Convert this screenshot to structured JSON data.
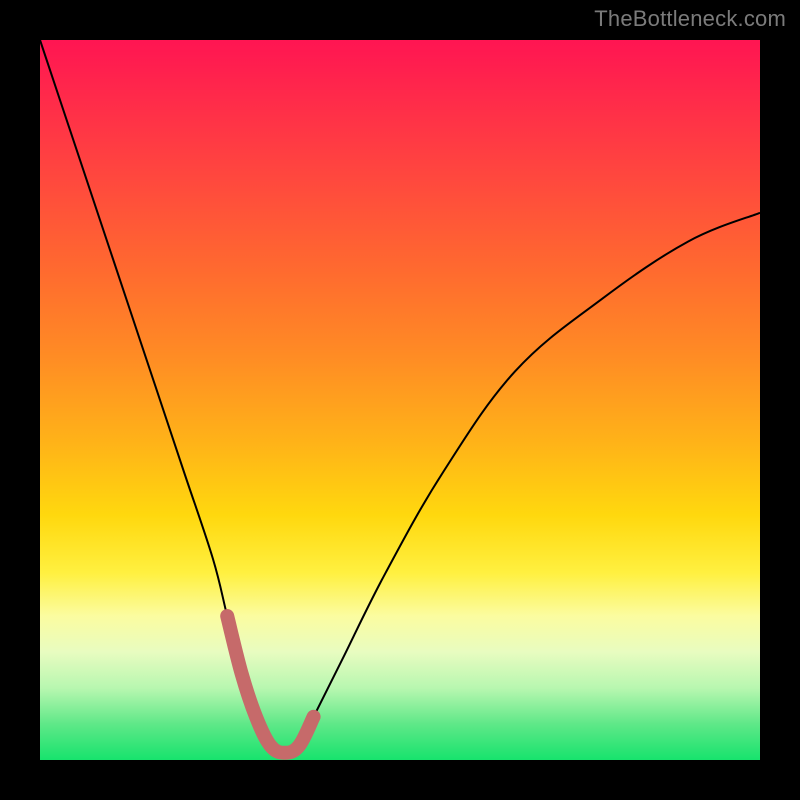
{
  "watermark": "TheBottleneck.com",
  "chart_data": {
    "type": "line",
    "title": "",
    "xlabel": "",
    "ylabel": "",
    "xlim": [
      0,
      100
    ],
    "ylim": [
      0,
      100
    ],
    "background_gradient": {
      "top_color": "#ff1552",
      "bottom_color": "#17e36d",
      "meaning": "high (red) = bottleneck, low (green) = balanced"
    },
    "series": [
      {
        "name": "bottleneck-curve",
        "x": [
          0,
          4,
          8,
          12,
          16,
          20,
          24,
          26,
          28,
          30,
          32,
          34,
          36,
          38,
          42,
          48,
          56,
          66,
          78,
          90,
          100
        ],
        "values": [
          100,
          88,
          76,
          64,
          52,
          40,
          28,
          20,
          12,
          6,
          2,
          1,
          2,
          6,
          14,
          26,
          40,
          54,
          64,
          72,
          76
        ]
      }
    ],
    "highlight_range": {
      "name": "optimal-region",
      "x": [
        26,
        28,
        30,
        32,
        34,
        36,
        38
      ],
      "values": [
        20,
        12,
        6,
        2,
        1,
        2,
        6
      ],
      "color": "#c66a6a"
    }
  }
}
